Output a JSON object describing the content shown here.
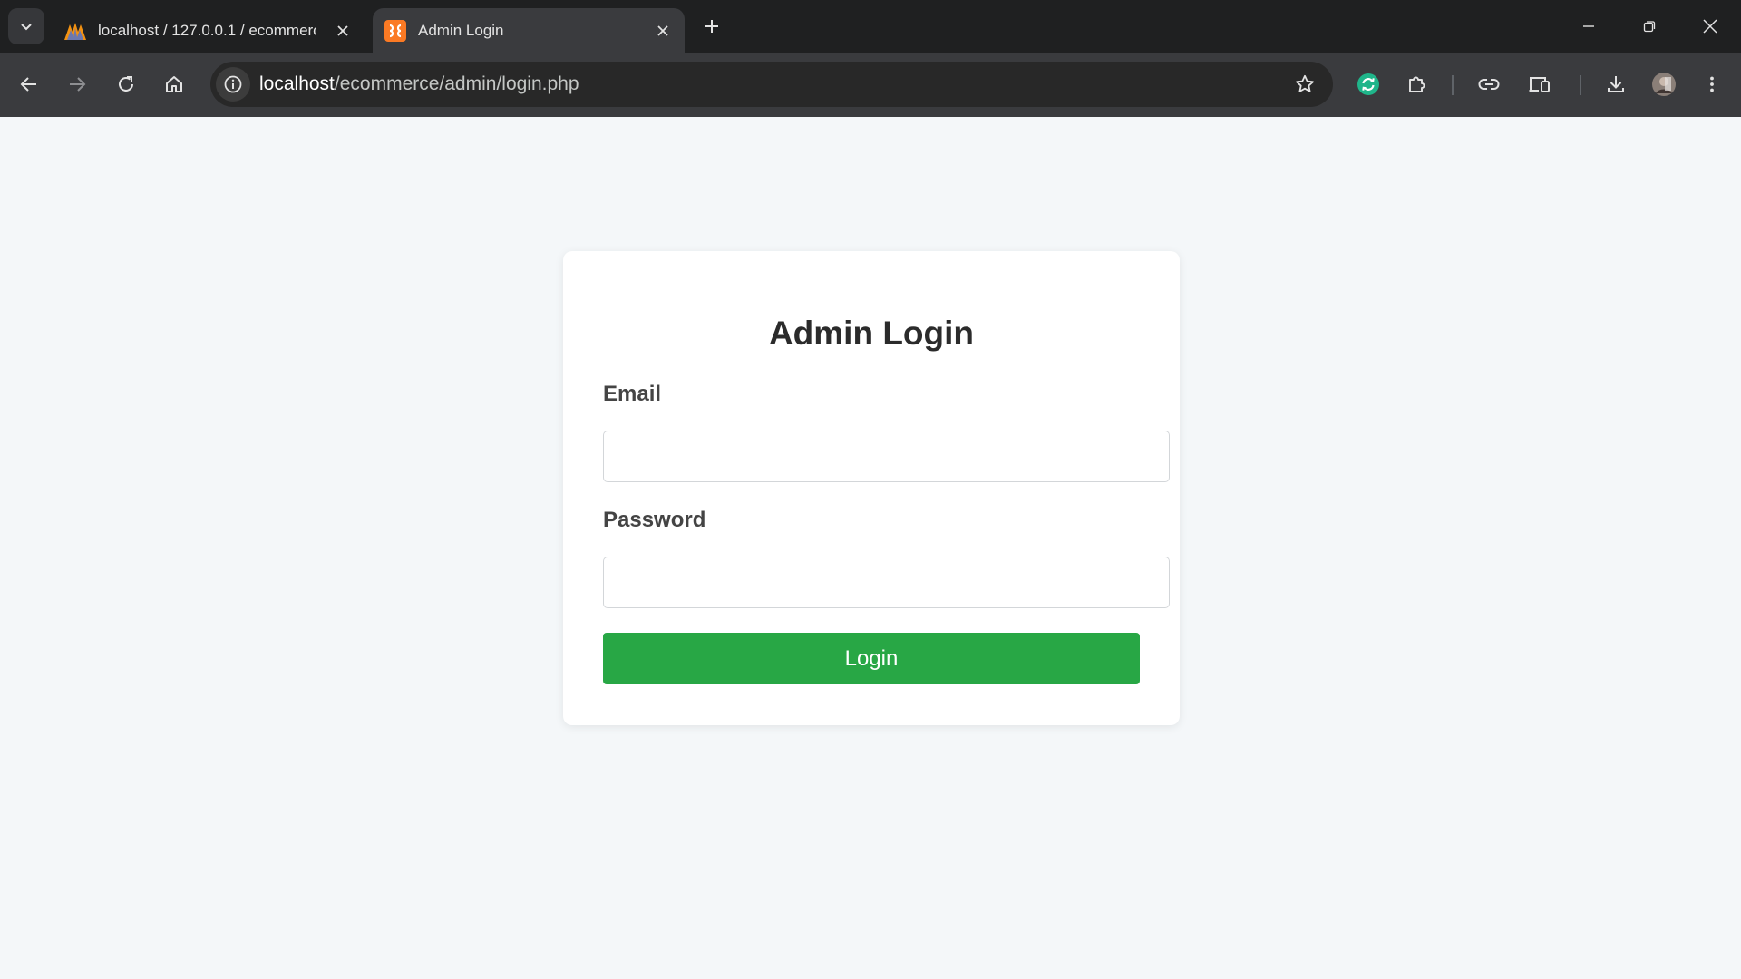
{
  "tabs": [
    {
      "title": "localhost / 127.0.0.1 / ecommerce",
      "favicon": "phpmyadmin-icon",
      "active": false
    },
    {
      "title": "Admin Login",
      "favicon": "xampp-icon",
      "active": true
    }
  ],
  "address_bar": {
    "host": "localhost",
    "path": "/ecommerce/admin/login.php"
  },
  "icons": {
    "tab_search": "chevron-down-icon",
    "back": "back-arrow-icon",
    "forward": "forward-arrow-icon",
    "reload": "reload-icon",
    "home": "home-icon",
    "site_info": "info-icon",
    "bookmark": "star-icon",
    "extension_sync": "sync-extension-icon",
    "extensions": "puzzle-icon",
    "link": "link-icon",
    "devices": "devices-icon",
    "downloads": "download-icon",
    "profile": "avatar",
    "menu": "kebab-menu-icon"
  },
  "login": {
    "title": "Admin Login",
    "email_label": "Email",
    "email_value": "",
    "password_label": "Password",
    "password_value": "",
    "submit_label": "Login"
  },
  "colors": {
    "button_green": "#28a745",
    "page_bg": "#f4f7f9",
    "card_bg": "#ffffff",
    "sync_teal": "#1fb58a"
  }
}
